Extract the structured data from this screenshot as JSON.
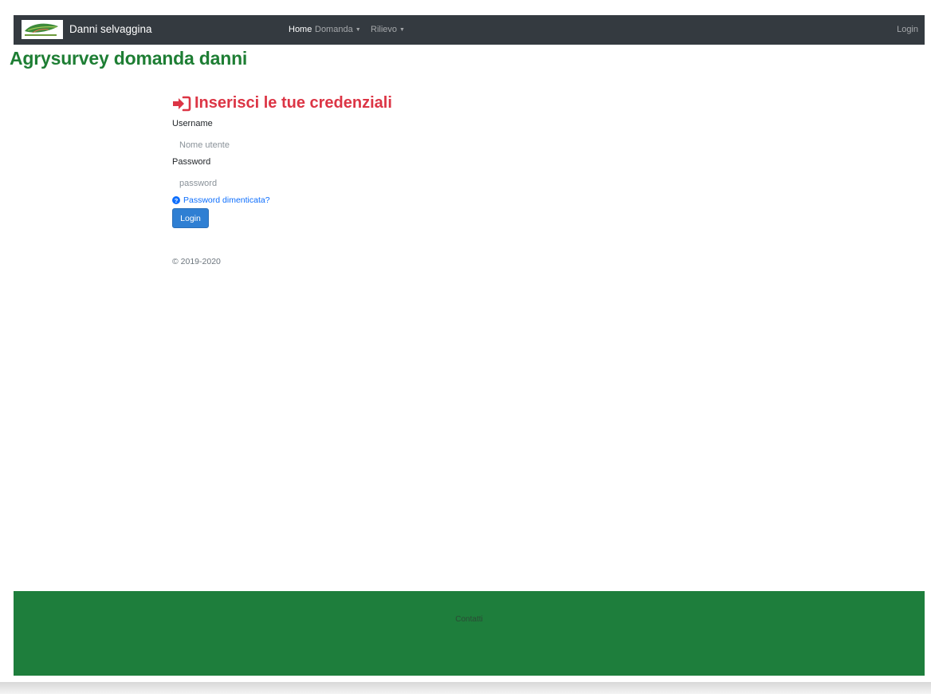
{
  "navbar": {
    "brand": "Danni selvaggina",
    "items": [
      {
        "label": "Home",
        "active": true
      },
      {
        "label": "Domanda",
        "dropdown": true
      },
      {
        "label": "Rilievo",
        "dropdown": true
      }
    ],
    "right": {
      "label": "Login"
    }
  },
  "page": {
    "title": "Agrysurvey domanda danni"
  },
  "login_form": {
    "heading": "Inserisci le tue credenziali",
    "username_label": "Username",
    "username_placeholder": "Nome utente",
    "password_label": "Password",
    "password_placeholder": "password",
    "forgot_link": "Password dimenticata?",
    "submit_label": "Login"
  },
  "copyright": "© 2019-2020",
  "footer": {
    "title": "Contatti",
    "link": ""
  },
  "colors": {
    "navbar_bg": "#343a40",
    "title_green": "#1e7e34",
    "heading_red": "#dc3545",
    "link_blue": "#0d6efd",
    "button_blue": "#2f7fd3",
    "footer_green": "#1e7e3c"
  }
}
